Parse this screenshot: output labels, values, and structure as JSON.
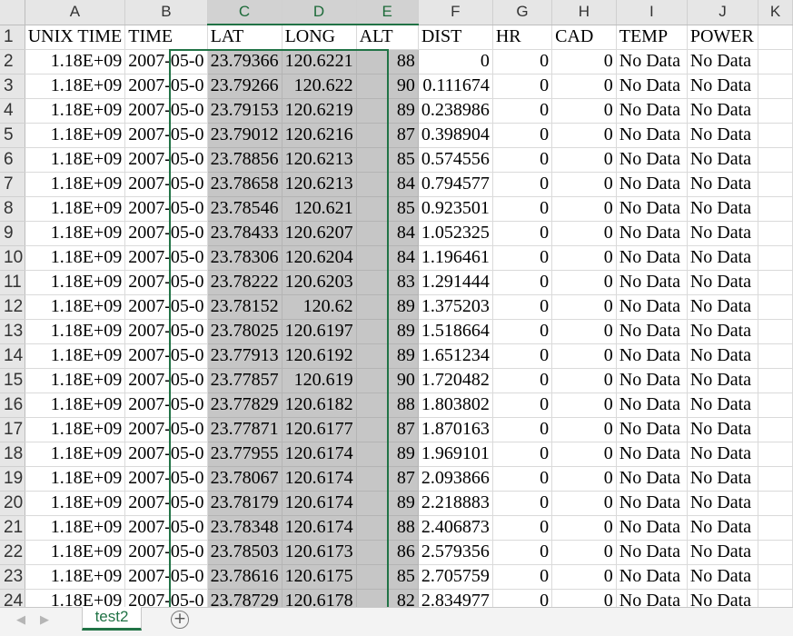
{
  "sheet": {
    "tab_name": "test2",
    "add_sheet_label": "+",
    "nav_prev": "◀",
    "nav_next": "▶",
    "accent_color": "#217346",
    "columns": [
      "A",
      "B",
      "C",
      "D",
      "E",
      "F",
      "G",
      "H",
      "I",
      "J",
      "K"
    ],
    "selected_columns": [
      "C",
      "D",
      "E"
    ],
    "row_numbers": [
      "1",
      "2",
      "3",
      "4",
      "5",
      "6",
      "7",
      "8",
      "9",
      "10",
      "11",
      "12",
      "13",
      "14",
      "15",
      "16",
      "17",
      "18",
      "19",
      "20",
      "21",
      "22",
      "23",
      "24"
    ],
    "header_row": [
      "UNIX TIME",
      "TIME",
      "LAT",
      "LONG",
      "ALT",
      "DIST",
      "HR",
      "CAD",
      "TEMP",
      "POWER",
      ""
    ],
    "rows": [
      [
        "1.18E+09",
        "2007-05-0",
        "23.79366",
        "120.6221",
        "88",
        "0",
        "0",
        "0",
        "No Data",
        "No Data",
        ""
      ],
      [
        "1.18E+09",
        "2007-05-0",
        "23.79266",
        "120.622",
        "90",
        "0.111674",
        "0",
        "0",
        "No Data",
        "No Data",
        ""
      ],
      [
        "1.18E+09",
        "2007-05-0",
        "23.79153",
        "120.6219",
        "89",
        "0.238986",
        "0",
        "0",
        "No Data",
        "No Data",
        ""
      ],
      [
        "1.18E+09",
        "2007-05-0",
        "23.79012",
        "120.6216",
        "87",
        "0.398904",
        "0",
        "0",
        "No Data",
        "No Data",
        ""
      ],
      [
        "1.18E+09",
        "2007-05-0",
        "23.78856",
        "120.6213",
        "85",
        "0.574556",
        "0",
        "0",
        "No Data",
        "No Data",
        ""
      ],
      [
        "1.18E+09",
        "2007-05-0",
        "23.78658",
        "120.6213",
        "84",
        "0.794577",
        "0",
        "0",
        "No Data",
        "No Data",
        ""
      ],
      [
        "1.18E+09",
        "2007-05-0",
        "23.78546",
        "120.621",
        "85",
        "0.923501",
        "0",
        "0",
        "No Data",
        "No Data",
        ""
      ],
      [
        "1.18E+09",
        "2007-05-0",
        "23.78433",
        "120.6207",
        "84",
        "1.052325",
        "0",
        "0",
        "No Data",
        "No Data",
        ""
      ],
      [
        "1.18E+09",
        "2007-05-0",
        "23.78306",
        "120.6204",
        "84",
        "1.196461",
        "0",
        "0",
        "No Data",
        "No Data",
        ""
      ],
      [
        "1.18E+09",
        "2007-05-0",
        "23.78222",
        "120.6203",
        "83",
        "1.291444",
        "0",
        "0",
        "No Data",
        "No Data",
        ""
      ],
      [
        "1.18E+09",
        "2007-05-0",
        "23.78152",
        "120.62",
        "89",
        "1.375203",
        "0",
        "0",
        "No Data",
        "No Data",
        ""
      ],
      [
        "1.18E+09",
        "2007-05-0",
        "23.78025",
        "120.6197",
        "89",
        "1.518664",
        "0",
        "0",
        "No Data",
        "No Data",
        ""
      ],
      [
        "1.18E+09",
        "2007-05-0",
        "23.77913",
        "120.6192",
        "89",
        "1.651234",
        "0",
        "0",
        "No Data",
        "No Data",
        ""
      ],
      [
        "1.18E+09",
        "2007-05-0",
        "23.77857",
        "120.619",
        "90",
        "1.720482",
        "0",
        "0",
        "No Data",
        "No Data",
        ""
      ],
      [
        "1.18E+09",
        "2007-05-0",
        "23.77829",
        "120.6182",
        "88",
        "1.803802",
        "0",
        "0",
        "No Data",
        "No Data",
        ""
      ],
      [
        "1.18E+09",
        "2007-05-0",
        "23.77871",
        "120.6177",
        "87",
        "1.870163",
        "0",
        "0",
        "No Data",
        "No Data",
        ""
      ],
      [
        "1.18E+09",
        "2007-05-0",
        "23.77955",
        "120.6174",
        "89",
        "1.969101",
        "0",
        "0",
        "No Data",
        "No Data",
        ""
      ],
      [
        "1.18E+09",
        "2007-05-0",
        "23.78067",
        "120.6174",
        "87",
        "2.093866",
        "0",
        "0",
        "No Data",
        "No Data",
        ""
      ],
      [
        "1.18E+09",
        "2007-05-0",
        "23.78179",
        "120.6174",
        "89",
        "2.218883",
        "0",
        "0",
        "No Data",
        "No Data",
        ""
      ],
      [
        "1.18E+09",
        "2007-05-0",
        "23.78348",
        "120.6174",
        "88",
        "2.406873",
        "0",
        "0",
        "No Data",
        "No Data",
        ""
      ],
      [
        "1.18E+09",
        "2007-05-0",
        "23.78503",
        "120.6173",
        "86",
        "2.579356",
        "0",
        "0",
        "No Data",
        "No Data",
        ""
      ],
      [
        "1.18E+09",
        "2007-05-0",
        "23.78616",
        "120.6175",
        "85",
        "2.705759",
        "0",
        "0",
        "No Data",
        "No Data",
        ""
      ],
      [
        "1.18E+09",
        "2007-05-0",
        "23.78729",
        "120.6178",
        "82",
        "2.834977",
        "0",
        "0",
        "No Data",
        "No Data",
        ""
      ]
    ]
  }
}
